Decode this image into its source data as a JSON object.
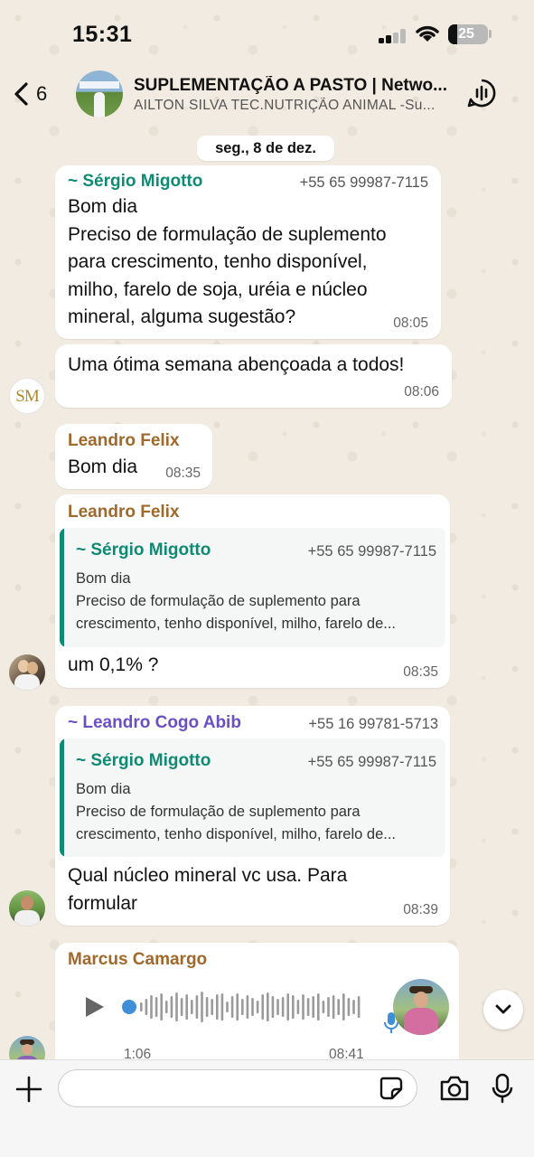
{
  "status_bar": {
    "time": "15:31",
    "battery": "25"
  },
  "header": {
    "back_count": "6",
    "title": "SUPLEMENTAÇÃO A PASTO | Netwo...",
    "subtitle": "AILTON SILVA TEC.NUTRIÇÃO ANIMAL  -Su..."
  },
  "date_chip": "seg., 8 de dez.",
  "messages": [
    {
      "sender": "~ Sérgio Migotto",
      "phone": "+55 65 99987-7115",
      "lines": [
        "Bom dia",
        "Preciso de formulação de suplemento",
        "para crescimento, tenho disponível,",
        "milho, farelo de soja, uréia e núcleo",
        "mineral, alguma sugestão?"
      ],
      "time": "08:05"
    },
    {
      "text": "Uma ótima semana abençoada a todos!",
      "time": "08:06",
      "avatar_initials": "SM"
    },
    {
      "sender": "Leandro Felix",
      "text": "Bom dia",
      "time": "08:35"
    },
    {
      "sender": "Leandro Felix",
      "quote": {
        "sender": "~ Sérgio Migotto",
        "phone": "+55 65 99987-7115",
        "lines": [
          "Bom dia",
          "Preciso de formulação de suplemento para",
          "crescimento, tenho disponível, milho, farelo de..."
        ]
      },
      "text": "um 0,1% ?",
      "time": "08:35"
    },
    {
      "sender": "~ Leandro Cogo Abib",
      "phone": "+55 16 99781-5713",
      "quote": {
        "sender": "~ Sérgio Migotto",
        "phone": "+55 65 99987-7115",
        "lines": [
          "Bom dia",
          "Preciso de formulação de suplemento para",
          "crescimento, tenho disponível, milho, farelo de..."
        ]
      },
      "lines": [
        "Qual núcleo mineral vc usa. Para",
        "formular"
      ],
      "time": "08:39"
    },
    {
      "sender": "Marcus Camargo",
      "audio_duration": "1:06",
      "time": "08:41"
    }
  ],
  "colors": {
    "teal": "#0f8a73",
    "brown": "#a0682b",
    "purple": "#6b4fc4",
    "olive": "#8a7a1e"
  }
}
